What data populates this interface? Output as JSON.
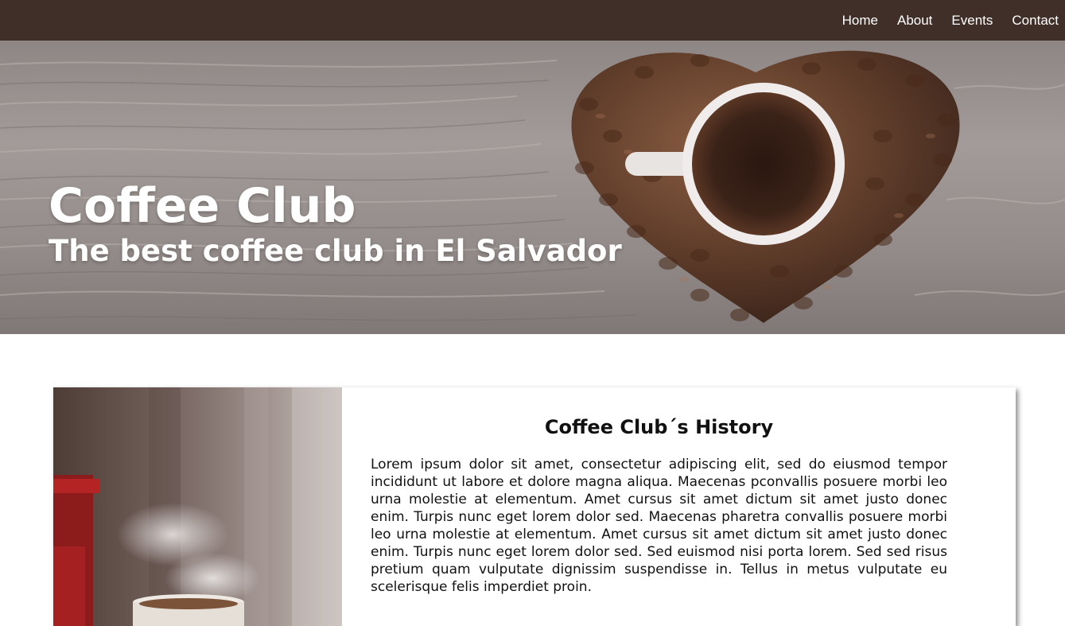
{
  "nav": {
    "items": [
      {
        "label": "Home"
      },
      {
        "label": "About"
      },
      {
        "label": "Events"
      },
      {
        "label": "Contact"
      }
    ]
  },
  "hero": {
    "title": "Coffee Club",
    "subtitle": "The best coffee club in El Salvador"
  },
  "history": {
    "heading": "Coffee Club´s History",
    "body": "Lorem ipsum dolor sit amet, consectetur adipiscing elit, sed do eiusmod tempor incididunt ut labore et dolore magna aliqua. Maecenas pconvallis posuere morbi leo urna molestie at elementum. Amet cursus sit amet dictum sit amet justo donec enim. Turpis nunc eget lorem dolor sed. Maecenas pharetra convallis posuere morbi leo urna molestie at elementum. Amet cursus sit amet dictum sit amet justo donec enim. Turpis nunc eget lorem dolor sed. Sed euismod nisi porta lorem. Sed sed risus pretium quam vulputate dignissim suspendisse in. Tellus in metus vulputate eu scelerisque felis imperdiet proin."
  },
  "colors": {
    "navbar": "#3f2f28",
    "text": "#111111",
    "hero_text": "#ffffff"
  }
}
